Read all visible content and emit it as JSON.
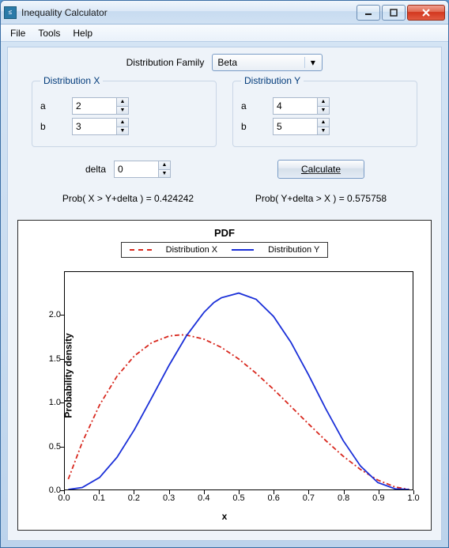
{
  "window": {
    "title": "Inequality Calculator"
  },
  "menu": {
    "items": [
      "File",
      "Tools",
      "Help"
    ]
  },
  "distFamily": {
    "label": "Distribution Family",
    "value": "Beta"
  },
  "distX": {
    "title": "Distribution X",
    "params": [
      {
        "name": "a",
        "value": "2"
      },
      {
        "name": "b",
        "value": "3"
      }
    ]
  },
  "distY": {
    "title": "Distribution Y",
    "params": [
      {
        "name": "a",
        "value": "4"
      },
      {
        "name": "b",
        "value": "5"
      }
    ]
  },
  "delta": {
    "label": "delta",
    "value": "0"
  },
  "calc": {
    "label": "Calculate"
  },
  "results": {
    "prob1": "Prob( X > Y+delta ) = 0.424242",
    "prob2": "Prob( Y+delta > X ) = 0.575758"
  },
  "chart_data": {
    "type": "line",
    "title": "PDF",
    "xlabel": "x",
    "ylabel": "Probability density",
    "xlim": [
      0.0,
      1.0
    ],
    "ylim": [
      0.0,
      2.5
    ],
    "xticks": [
      0.0,
      0.1,
      0.2,
      0.3,
      0.4,
      0.5,
      0.6,
      0.7,
      0.8,
      0.9,
      1.0
    ],
    "yticks": [
      0.0,
      0.5,
      1.0,
      1.5,
      2.0
    ],
    "legend": [
      {
        "name": "Distribution X",
        "color": "#d8281e",
        "dash": "dashdot"
      },
      {
        "name": "Distribution Y",
        "color": "#1a2fd8",
        "dash": "solid"
      }
    ],
    "series": [
      {
        "name": "Distribution X",
        "x": [
          0.01,
          0.05,
          0.1,
          0.15,
          0.2,
          0.25,
          0.3,
          0.333,
          0.35,
          0.4,
          0.45,
          0.5,
          0.55,
          0.6,
          0.65,
          0.7,
          0.75,
          0.8,
          0.85,
          0.9,
          0.95,
          0.99
        ],
        "y": [
          0.118,
          0.541,
          0.972,
          1.301,
          1.536,
          1.688,
          1.764,
          1.778,
          1.775,
          1.728,
          1.634,
          1.5,
          1.336,
          1.152,
          0.955,
          0.756,
          0.563,
          0.384,
          0.23,
          0.108,
          0.028,
          0.001
        ]
      },
      {
        "name": "Distribution Y",
        "x": [
          0.01,
          0.05,
          0.1,
          0.15,
          0.2,
          0.25,
          0.3,
          0.35,
          0.4,
          0.4286,
          0.45,
          0.5,
          0.55,
          0.6,
          0.65,
          0.7,
          0.75,
          0.8,
          0.85,
          0.9,
          0.95,
          0.99
        ],
        "y": [
          0.0,
          0.023,
          0.138,
          0.37,
          0.688,
          1.056,
          1.43,
          1.769,
          2.036,
          2.149,
          2.204,
          2.258,
          2.186,
          1.99,
          1.692,
          1.323,
          0.93,
          0.564,
          0.27,
          0.079,
          0.007,
          0.0
        ]
      }
    ]
  }
}
